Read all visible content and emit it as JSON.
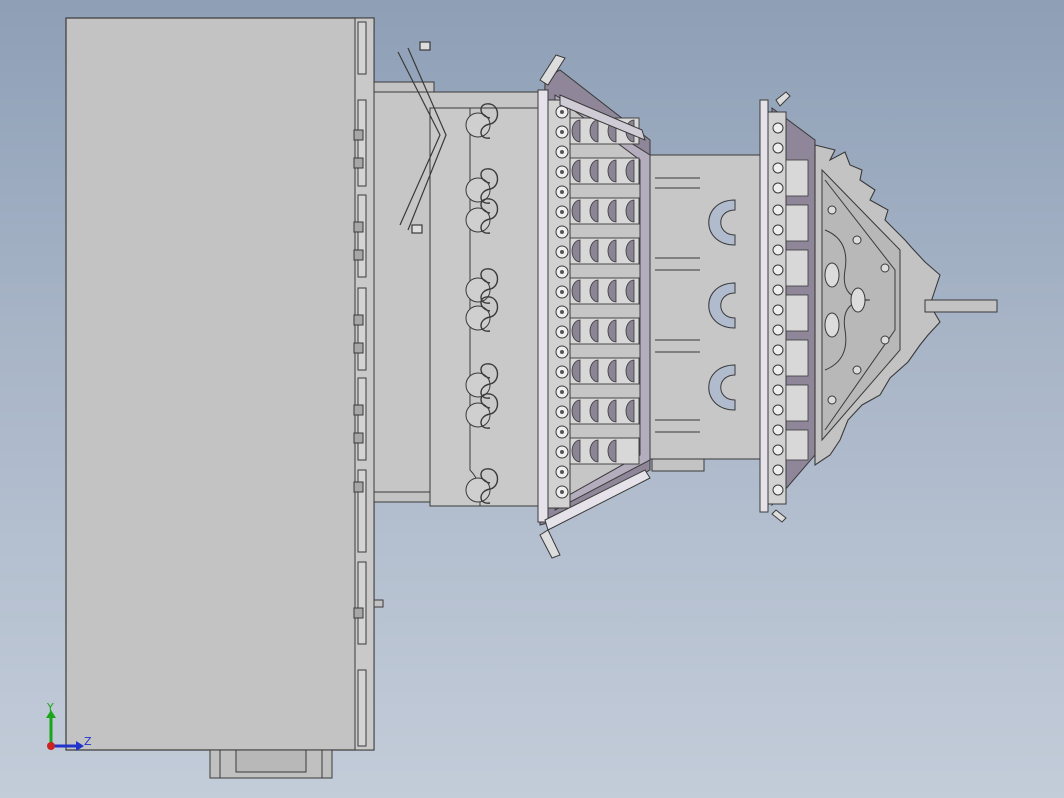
{
  "viewport": {
    "background_top": "#8e9fb6",
    "background_bottom": "#c3ccd9"
  },
  "model": {
    "body_color": "#c3c3c3",
    "face_color": "#b4b4b4",
    "edge_color": "#3a3a3a",
    "shade_color": "#8f8799",
    "light_color": "#e6e2ea"
  },
  "triad": {
    "y_label": "Y",
    "z_label": "Z",
    "y_color": "#1aa51a",
    "z_color": "#2233cc",
    "origin_color": "#cc2222"
  }
}
